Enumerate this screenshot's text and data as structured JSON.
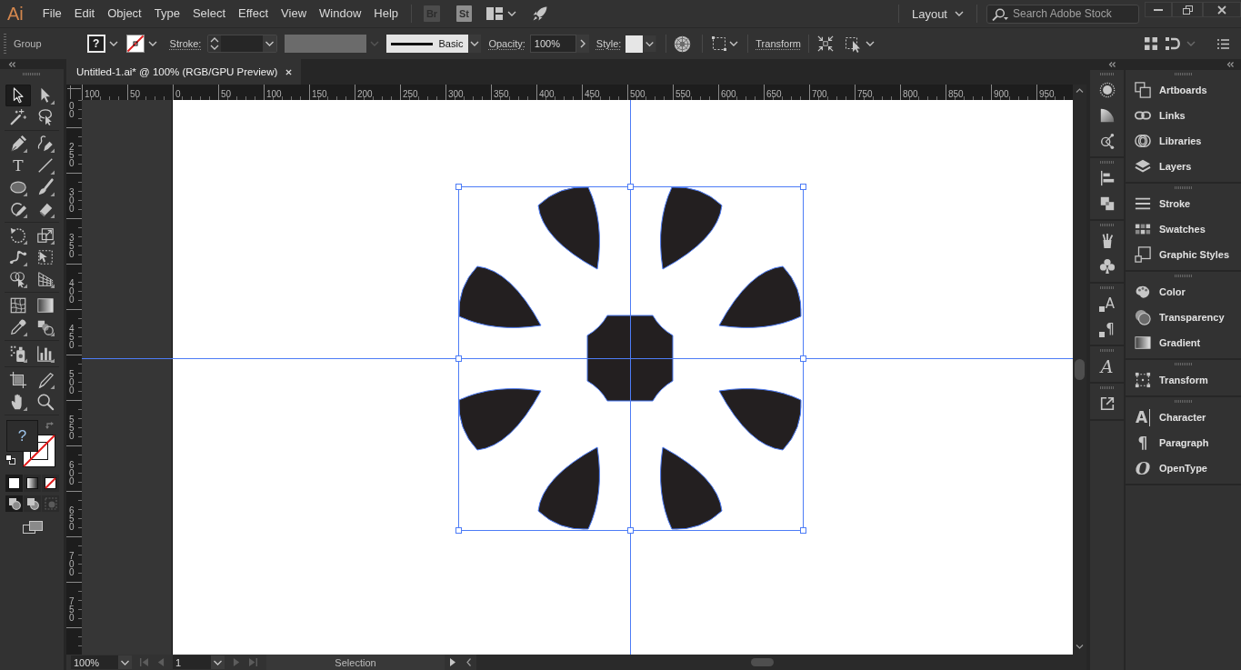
{
  "app_logo": "Ai",
  "menu": [
    "File",
    "Edit",
    "Object",
    "Type",
    "Select",
    "Effect",
    "View",
    "Window",
    "Help"
  ],
  "app_bar": {
    "bridge": "Br",
    "stock": "St",
    "workspace": "Layout",
    "search": {
      "placeholder": "Search Adobe Stock"
    }
  },
  "control_bar": {
    "selection": "Group",
    "fill": "?",
    "stroke_label": "Stroke:",
    "width_profile": {
      "disabled": true
    },
    "brush": "Basic",
    "opacity_label": "Opacity:",
    "opacity": "100%",
    "style_label": "Style:",
    "transform": "Transform"
  },
  "document_tab": {
    "title": "Untitled-1.ai* @ 100% (RGB/GPU Preview)"
  },
  "rulers": {
    "horizontal": [
      "100",
      "50",
      "0",
      "50",
      "100",
      "150",
      "200",
      "250",
      "300",
      "350",
      "400",
      "450",
      "500",
      "550",
      "600",
      "650",
      "700",
      "750",
      "800",
      "850",
      "900",
      "950"
    ],
    "vertical": [
      "00",
      "250",
      "300",
      "350",
      "400",
      "450",
      "500",
      "550",
      "600",
      "650",
      "700",
      "750"
    ]
  },
  "toolbar": {
    "groups": [
      [
        {
          "selected": true
        },
        {
          "selected": false
        },
        {
          "selected": false
        },
        {
          "selected": false
        }
      ],
      [
        {
          "selected": false
        },
        {
          "selected": false
        },
        {
          "selected": false,
          "glyph": "T"
        },
        {
          "selected": false
        },
        {
          "selected": false
        },
        {
          "selected": false
        },
        {
          "selected": false
        },
        {
          "selected": false
        }
      ],
      [
        {
          "selected": false
        },
        {
          "selected": false
        },
        {
          "selected": false
        },
        {
          "selected": false
        },
        {
          "selected": false
        },
        {
          "selected": false
        }
      ],
      [
        {
          "selected": false
        },
        {
          "selected": false
        },
        {
          "selected": false
        },
        {
          "selected": false
        }
      ],
      [
        {
          "selected": false
        },
        {
          "selected": false
        }
      ],
      [
        {
          "selected": false
        },
        {
          "selected": false
        },
        {
          "selected": false
        },
        {
          "selected": false
        }
      ]
    ],
    "fill": "?",
    "color_modes": [
      {
        "selected": true
      },
      {
        "selected": false
      },
      {
        "selected": false
      }
    ],
    "draw_modes": [
      {
        "selected": true,
        "disabled": false
      },
      {
        "selected": false,
        "disabled": false
      },
      {
        "selected": false,
        "disabled": true
      }
    ]
  },
  "status_bar": {
    "zoom": "100%",
    "nav_back": [
      {
        "disabled": true
      },
      {
        "disabled": true
      }
    ],
    "artboard": "1",
    "nav_forward": [
      {
        "disabled": true
      },
      {
        "disabled": true
      }
    ],
    "status": "Selection"
  },
  "dock_glyphs": [
    "A",
    "¶",
    "A"
  ],
  "panels": {
    "groups": [
      [
        {
          "label": "Artboards"
        },
        {
          "label": "Links"
        },
        {
          "label": "Libraries"
        },
        {
          "label": "Layers"
        }
      ],
      [
        {
          "label": "Stroke"
        },
        {
          "label": "Swatches"
        },
        {
          "label": "Graphic Styles"
        }
      ],
      [
        {
          "label": "Color"
        },
        {
          "label": "Transparency"
        },
        {
          "label": "Gradient"
        }
      ],
      [
        {
          "label": "Transform"
        }
      ],
      [
        {
          "label": "Character",
          "glyph": "A"
        },
        {
          "label": "Paragraph",
          "glyph": "¶"
        },
        {
          "label": "OpenType",
          "glyph": "O"
        }
      ]
    ]
  }
}
